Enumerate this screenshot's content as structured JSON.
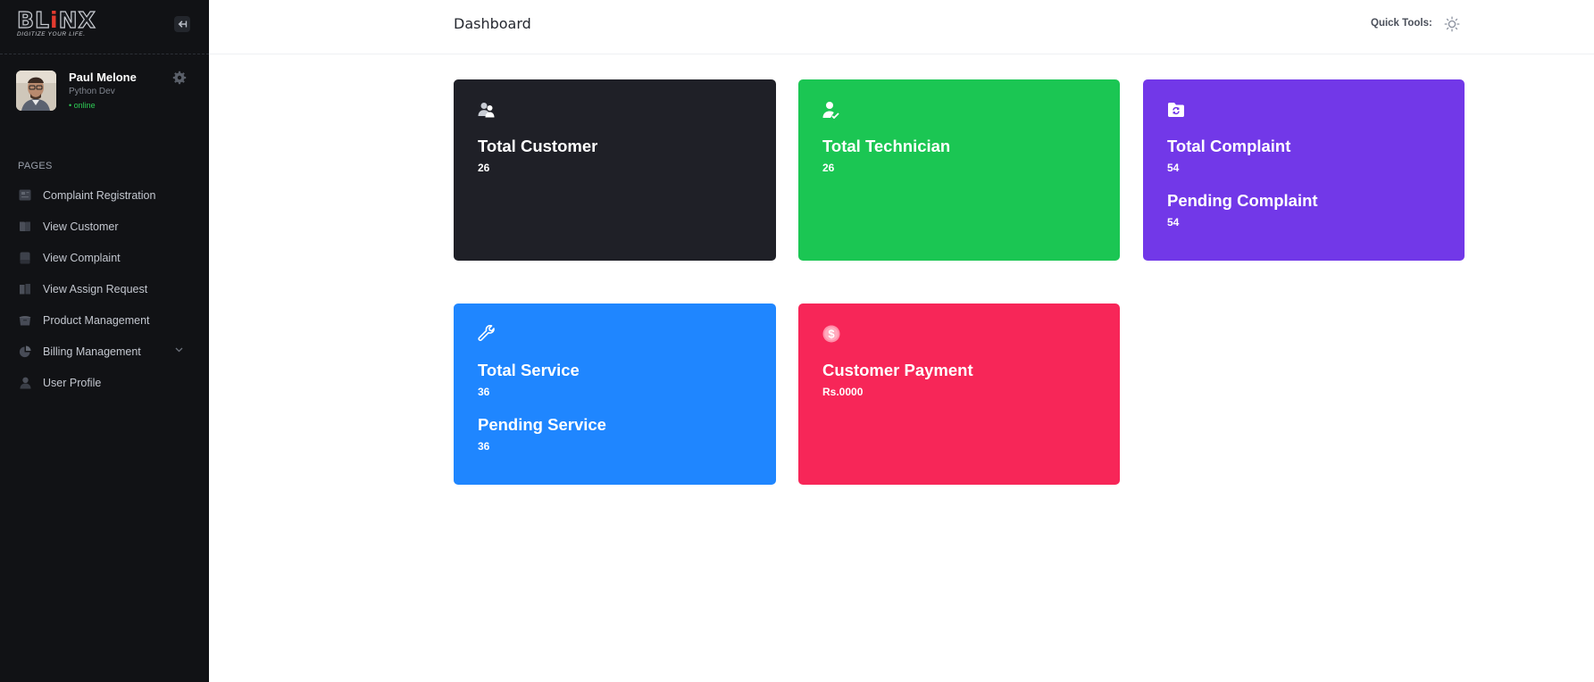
{
  "app": {
    "logo_text_a": "BL",
    "logo_text_i": "i",
    "logo_text_b": "NX",
    "logo_tagline": "DIGITIZE YOUR LIFE."
  },
  "user": {
    "name": "Paul Melone",
    "role": "Python Dev",
    "status": "• online"
  },
  "sidebar": {
    "section_title": "PAGES",
    "items": [
      {
        "label": "Complaint Registration",
        "icon": "complaint-form-icon"
      },
      {
        "label": "View Customer",
        "icon": "book-icon"
      },
      {
        "label": "View Complaint",
        "icon": "document-icon"
      },
      {
        "label": "View Assign Request",
        "icon": "book-open-icon"
      },
      {
        "label": "Product Management",
        "icon": "box-icon"
      },
      {
        "label": "Billing Management",
        "icon": "pie-chart-icon"
      },
      {
        "label": "User Profile",
        "icon": "user-icon"
      }
    ]
  },
  "header": {
    "title": "Dashboard",
    "quick_tools_label": "Quick Tools:"
  },
  "cards": [
    {
      "label": "Total Customer",
      "value": "26",
      "color": "#1f2027",
      "icon": "users-icon"
    },
    {
      "label": "Total Technician",
      "value": "26",
      "color": "#1bc653",
      "icon": "user-check-icon"
    },
    {
      "label": "Total Complaint",
      "value": "54",
      "label2": "Pending Complaint",
      "value2": "54",
      "color": "#7238e8",
      "icon": "folder-sync-icon"
    },
    {
      "label": "Total Service",
      "value": "36",
      "label2": "Pending Service",
      "value2": "36",
      "color": "#1f86ff",
      "icon": "wrench-icon"
    },
    {
      "label": "Customer Payment",
      "value": "Rs.0000",
      "color": "#f72658",
      "icon": "dollar-icon"
    }
  ],
  "colors": {
    "sidebar_bg": "#111215",
    "online": "#2ecc55"
  }
}
